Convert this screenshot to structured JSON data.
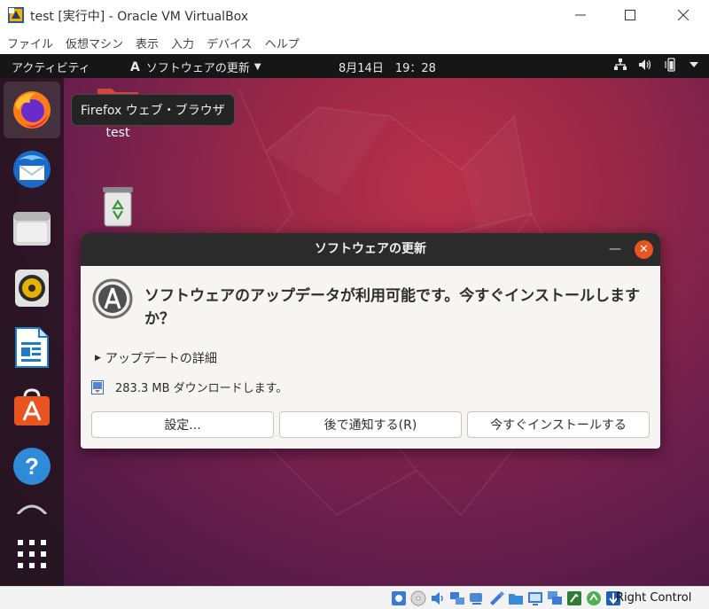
{
  "window": {
    "title": "test [実行中] - Oracle VM VirtualBox",
    "minimize_glyph": "—",
    "maximize_glyph": "☐",
    "close_glyph": "✕"
  },
  "menubar": {
    "items": [
      "ファイル",
      "仮想マシン",
      "表示",
      "入力",
      "デバイス",
      "ヘルプ"
    ]
  },
  "topbar": {
    "activities": "アクティビティ",
    "app_menu_glyph": "A",
    "app_menu_label": "ソフトウェアの更新",
    "app_menu_caret": "▼",
    "clock": "8月14日　19：28",
    "tray_icons": [
      "network-icon",
      "volume-icon",
      "battery-icon",
      "power-menu-icon"
    ]
  },
  "dock": {
    "items": [
      {
        "name": "firefox-icon",
        "active": true
      },
      {
        "name": "thunderbird-icon",
        "active": false
      },
      {
        "name": "files-icon",
        "active": false
      },
      {
        "name": "rhythmbox-icon",
        "active": false
      },
      {
        "name": "libreoffice-writer-icon",
        "active": false
      },
      {
        "name": "ubuntu-software-icon",
        "active": false
      },
      {
        "name": "help-icon",
        "active": false
      },
      {
        "name": "show-apps-icon",
        "active": false
      }
    ],
    "help_glyph": "?"
  },
  "tooltip": {
    "text": "Firefox ウェブ・ブラウザ"
  },
  "desktop": {
    "folder_label": "test",
    "trash_icon": "trash-icon"
  },
  "dialog": {
    "title": "ソフトウェアの更新",
    "minimize_glyph": "—",
    "close_glyph": "✕",
    "heading": "ソフトウェアのアップデータが利用可能です。今すぐインストールしますか？",
    "details_triangle": "▶",
    "details_label": "アップデートの詳細",
    "download_size": "283.3 MB ダウンロードします。",
    "buttons": {
      "settings": "設定...",
      "later": "後で通知する(R)",
      "install": "今すぐインストールする"
    },
    "accent_color": "#e95420"
  },
  "statusbar": {
    "host_key": "Right Control",
    "icons": [
      "hard-disk-icon",
      "optical-drive-icon",
      "audio-icon",
      "network-adapter-icon",
      "usb-icon",
      "shared-folder-icon",
      "display-icon",
      "video-capture-icon",
      "guest-additions-icon",
      "mouse-integration-icon",
      "keyboard-capture-icon"
    ]
  }
}
